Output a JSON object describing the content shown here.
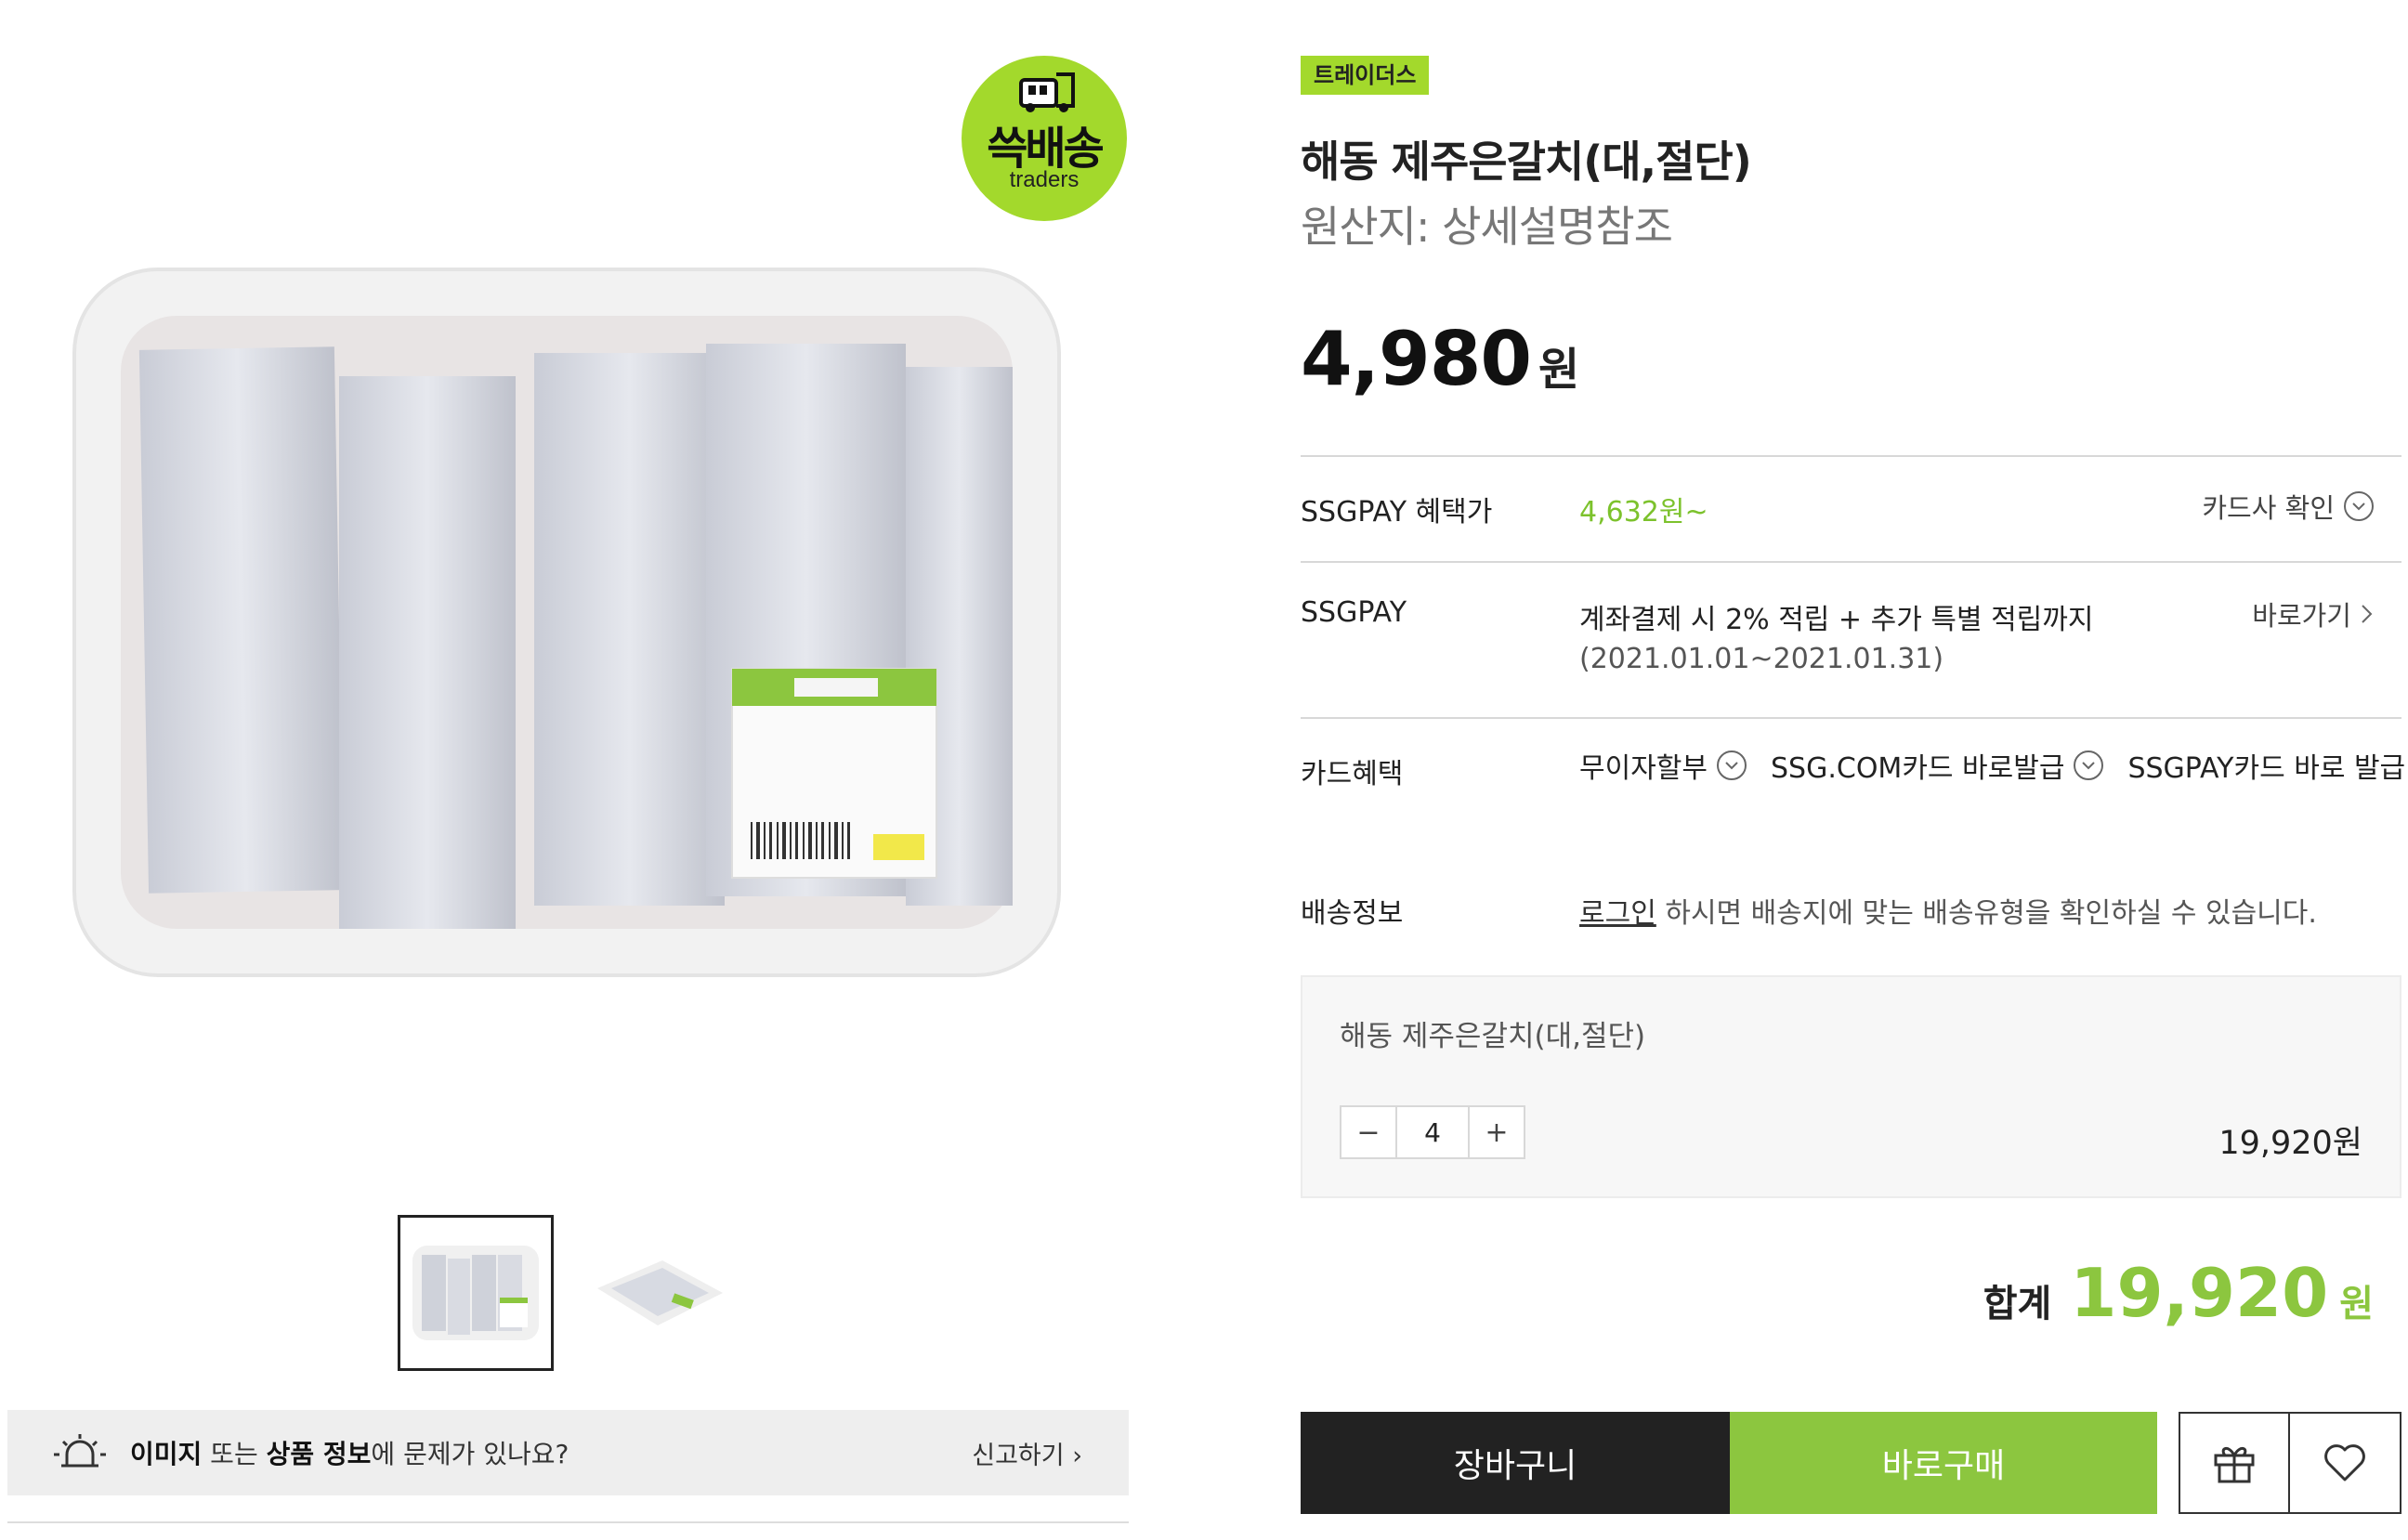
{
  "badge": {
    "main": "쓱배송",
    "sub": "traders"
  },
  "report": {
    "bold1": "이미지",
    "text1": " 또는 ",
    "bold2": "상품 정보",
    "text2": "에 문제가 있나요?",
    "link": "신고하기 ›"
  },
  "product": {
    "brand": "트레이더스",
    "title": "해동 제주은갈치(대,절단)",
    "origin": "원산지: 상세설명참조",
    "price": "4,980",
    "price_unit": "원"
  },
  "ssgpay_benefit": {
    "label": "SSGPAY 혜택가",
    "value": "4,632원~",
    "link": "카드사 확인"
  },
  "ssgpay": {
    "label": "SSGPAY",
    "line1": "계좌결제 시 2% 적립 + 추가 특별 적립까지",
    "line2": "(2021.01.01~2021.01.31)",
    "link": "바로가기"
  },
  "card_benefits": {
    "label": "카드혜택",
    "items": [
      "무이자할부",
      "SSG.COM카드 바로발급",
      "SSGPAY카드 바로 발급"
    ]
  },
  "delivery": {
    "label": "배송정보",
    "login_link": "로그인",
    "rest": " 하시면 배송지에 맞는 배송유형을 확인하실 수 있습니다."
  },
  "option": {
    "name": "해동 제주은갈치(대,절단)",
    "minus": "−",
    "quantity": "4",
    "plus": "+",
    "price": "19,920원"
  },
  "total": {
    "label": "합계",
    "value": "19,920",
    "unit": "원"
  },
  "actions": {
    "cart": "장바구니",
    "buy": "바로구매"
  },
  "colors": {
    "accent_green": "#8cc63f",
    "brand_tag": "#a3d92c",
    "dark": "#222222"
  }
}
